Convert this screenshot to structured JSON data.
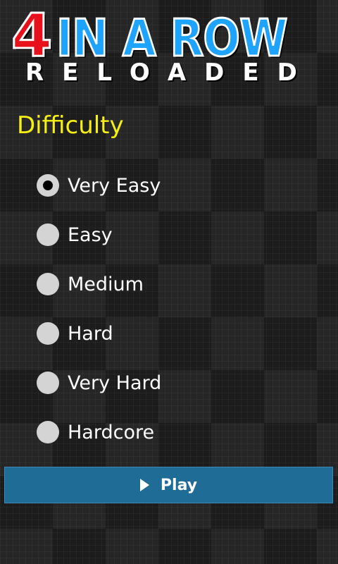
{
  "logo": {
    "number": "4",
    "words": "IN A ROW",
    "subtitle": "RELOADED"
  },
  "difficulty": {
    "heading": "Difficulty",
    "selected_index": 0,
    "options": [
      {
        "label": "Very Easy",
        "selected": true
      },
      {
        "label": "Easy",
        "selected": false
      },
      {
        "label": "Medium",
        "selected": false
      },
      {
        "label": "Hard",
        "selected": false
      },
      {
        "label": "Very Hard",
        "selected": false
      },
      {
        "label": "Hardcore",
        "selected": false
      }
    ]
  },
  "play_button": {
    "label": "Play",
    "icon": "play-icon"
  },
  "colors": {
    "heading": "#f5ef12",
    "logo_red": "#e8101a",
    "logo_blue": "#1ea4ff",
    "play_button": "#1f6c97",
    "radio": "#d4d4d4"
  }
}
